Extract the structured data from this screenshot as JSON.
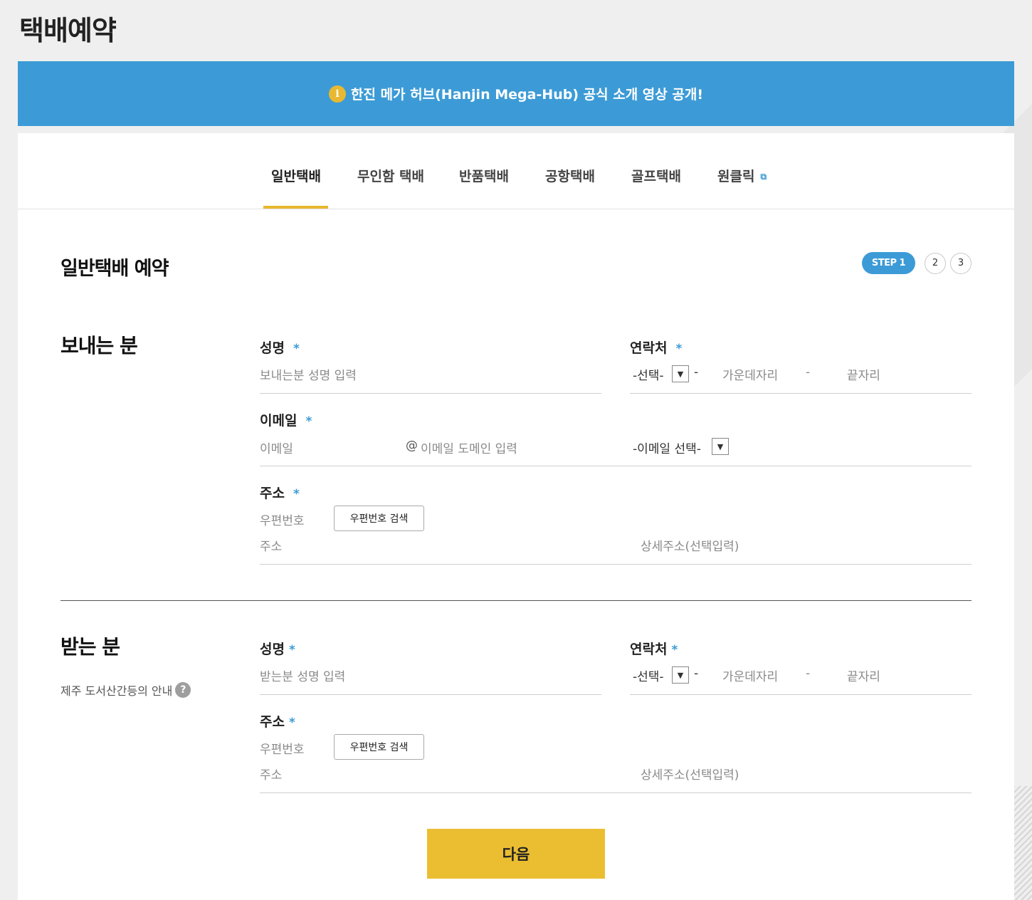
{
  "page": {
    "title": "택배예약"
  },
  "notice": {
    "icon": "info-icon",
    "icon_glyph": "i",
    "text": "한진 메가 허브(Hanjin Mega-Hub) 공식 소개 영상 공개!"
  },
  "tabs": [
    {
      "label": "일반택배",
      "active": true
    },
    {
      "label": "무인함 택배"
    },
    {
      "label": "반품택배"
    },
    {
      "label": "공항택배"
    },
    {
      "label": "골프택배"
    },
    {
      "label": "원클릭",
      "icon": "external-link-icon",
      "icon_glyph": "⧉"
    }
  ],
  "section": {
    "title": "일반택배 예약"
  },
  "steps": {
    "current": "STEP 1",
    "step2": "2",
    "step3": "3"
  },
  "sender": {
    "title": "보내는 분",
    "name_label": "성명",
    "name_placeholder": "보내는분 성명 입력",
    "phone_label": "연락처",
    "phone_select": "-선택-",
    "phone_dash1": "-",
    "phone_mid_placeholder": "가운데자리",
    "phone_dash2": "-",
    "phone_last_placeholder": "끝자리",
    "email_label": "이메일",
    "email_placeholder": "이메일",
    "email_at": "@",
    "email_domain_placeholder": "이메일 도메인 입력",
    "email_select": "-이메일 선택-",
    "address_label": "주소",
    "zip_placeholder": "우편번호",
    "zip_button": "우편번호 검색",
    "address_placeholder": "주소",
    "detail_placeholder": "상세주소(선택입력)"
  },
  "receiver": {
    "title": "받는 분",
    "help_text": "제주 도서산간등의 안내",
    "help_icon": "question-icon",
    "help_glyph": "?",
    "name_label": "성명",
    "name_placeholder": "받는분 성명 입력",
    "phone_label": "연락처",
    "phone_select": "-선택-",
    "phone_dash1": "-",
    "phone_mid_placeholder": "가운데자리",
    "phone_dash2": "-",
    "phone_last_placeholder": "끝자리",
    "address_label": "주소",
    "zip_placeholder": "우편번호",
    "zip_button": "우편번호 검색",
    "address_placeholder": "주소",
    "detail_placeholder": "상세주소(선택입력)"
  },
  "required_mark": "*",
  "select_arrow": "▼",
  "next_button": "다음",
  "colors": {
    "accent_blue": "#3c9bd6",
    "accent_yellow": "#ebbe32"
  }
}
